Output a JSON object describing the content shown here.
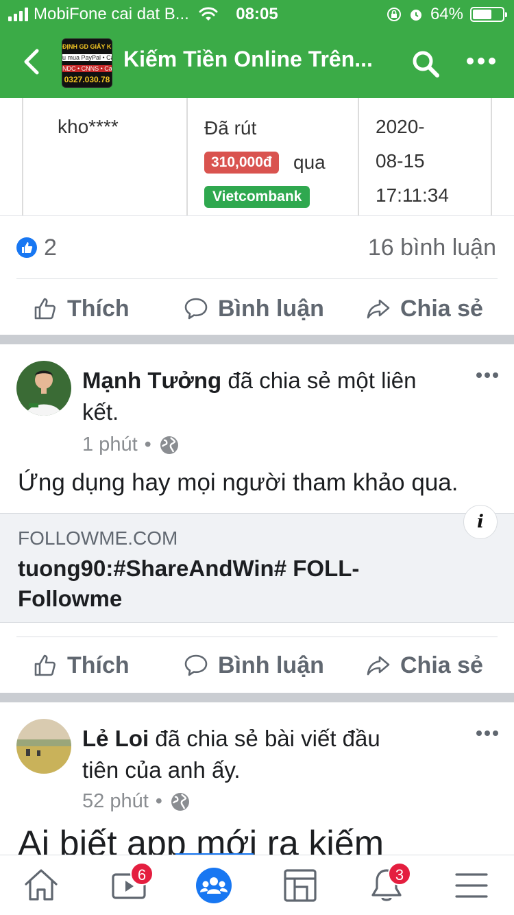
{
  "status_bar": {
    "carrier": "MobiFone cai dat B...",
    "time": "08:05",
    "battery_percent": "64%",
    "battery_level": 0.64
  },
  "nav": {
    "title": "Kiếm Tiền Online Trên...",
    "group_thumb_lines": [
      "ĐỊNH GD GIẤY KHM",
      "u mua PayPal • Ca",
      "NDC • CNNS • Ca",
      "0327.030.78"
    ]
  },
  "withdraw_table": {
    "user": "kho****",
    "status": "Đã rút",
    "amount": "310,000đ",
    "via": "qua",
    "bank": "Vietcombank",
    "date_lines": [
      "2020-",
      "08-15",
      "17:11:34"
    ],
    "colors": {
      "amount_badge": "#d9534f",
      "bank_badge": "#2fa84f"
    }
  },
  "first_post": {
    "like_count": "2",
    "comment_count": "16 bình luận"
  },
  "actions": {
    "like": "Thích",
    "comment": "Bình luận",
    "share": "Chia sẻ"
  },
  "post1": {
    "author": "Mạnh Tưởng",
    "activity_line1": " đã chia sẻ một liên",
    "activity_line2": "kết.",
    "time": "1 phút",
    "dot": "•",
    "text": "Ứng dụng hay mọi người tham khảo qua.",
    "link": {
      "domain": "FOLLOWME.COM",
      "title": "tuong90:#ShareAndWin# FOLL-Followme",
      "info_icon": "i"
    }
  },
  "post2": {
    "author": "Lẻ Loi",
    "activity_line1": " đã chia sẻ bài viết đầu",
    "activity_line2": "tiên của anh ấy.",
    "time": "52 phút",
    "dot": "•",
    "text": "Ai biết app mới ra kiếm"
  },
  "tabbar": {
    "tabs": [
      {
        "name": "home",
        "icon": "home-icon"
      },
      {
        "name": "watch",
        "icon": "video-icon",
        "badge": "6"
      },
      {
        "name": "groups",
        "icon": "groups-icon",
        "active": true
      },
      {
        "name": "pages",
        "icon": "pages-icon"
      },
      {
        "name": "notifications",
        "icon": "bell-icon",
        "badge": "3"
      },
      {
        "name": "menu",
        "icon": "hamburger-icon"
      }
    ]
  },
  "colors": {
    "nav_green": "#3bab47",
    "facebook_blue": "#1877f2",
    "badge_red": "#e41e3f"
  }
}
